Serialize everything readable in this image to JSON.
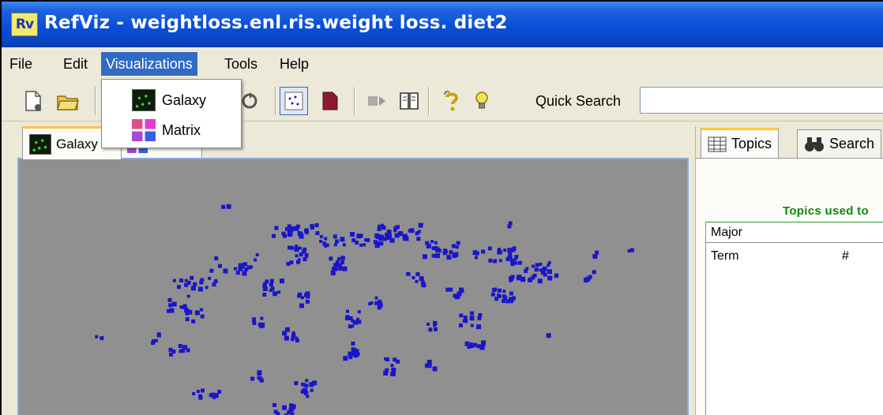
{
  "window": {
    "app_logo": "Rv",
    "title": "RefViz - weightloss.enl.ris.weight loss. diet2"
  },
  "menubar": {
    "items": [
      {
        "label": "File"
      },
      {
        "label": "Edit"
      },
      {
        "label": "Visualizations",
        "active": true
      },
      {
        "label": "Tools"
      },
      {
        "label": "Help"
      }
    ]
  },
  "toolbar": {
    "icons": [
      "new-document-icon",
      "open-folder-icon",
      "refresh-icon",
      "galaxy-view-icon",
      "bookmark-icon",
      "arrow-icon",
      "book-icon",
      "help-icon",
      "tip-lightbulb-icon"
    ],
    "quick_search_label": "Quick Search",
    "quick_search_value": ""
  },
  "dropdown": {
    "items": [
      {
        "label": "Galaxy",
        "icon": "galaxy-icon"
      },
      {
        "label": "Matrix",
        "icon": "matrix-icon"
      }
    ]
  },
  "left_tabs": {
    "galaxy_label": "Galaxy"
  },
  "right_panel": {
    "tabs": [
      {
        "label": "Topics",
        "icon": "topics-table-icon",
        "active": true
      },
      {
        "label": "Search",
        "icon": "binoculars-icon"
      }
    ],
    "heading": "Topics used to",
    "major_label": "Major",
    "columns": [
      "Term",
      "#"
    ]
  },
  "colors": {
    "title_bar": "#0a4ed8",
    "canvas_bg": "#909090",
    "dots": "#1a16c8",
    "heading_green": "#0a8a0a",
    "menu_highlight": "#316ac5"
  }
}
